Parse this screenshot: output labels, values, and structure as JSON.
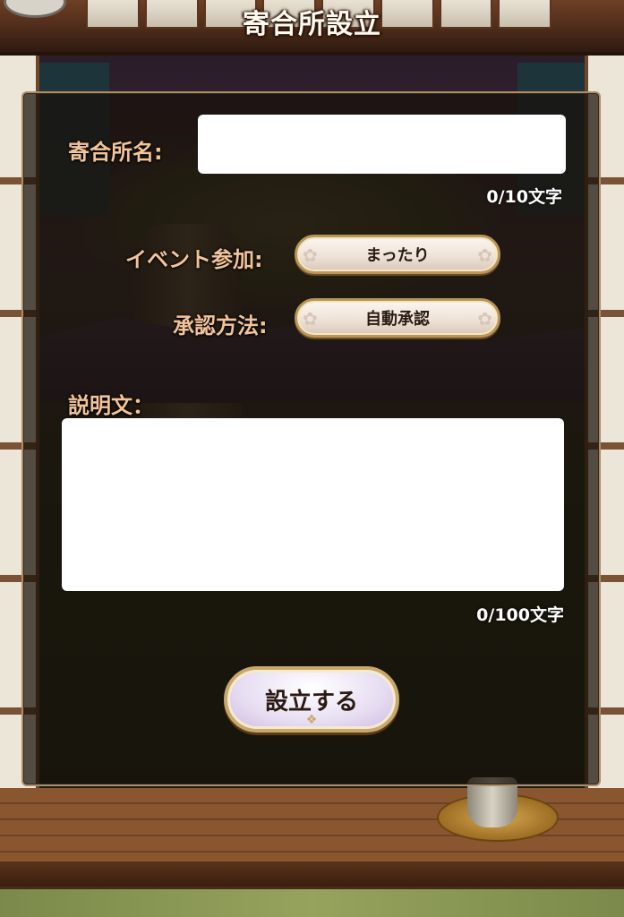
{
  "header": {
    "title": "寄合所設立"
  },
  "form": {
    "name_label": "寄合所名:",
    "name_value": "",
    "name_count": "0/10文字",
    "event_label": "イベント参加:",
    "event_value": "まったり",
    "approval_label": "承認方法:",
    "approval_value": "自動承認",
    "desc_label": "説明文：",
    "desc_value": "",
    "desc_count": "0/100文字",
    "submit_label": "設立する"
  },
  "icons": {
    "pill_ornament": "cherry-blossom-icon",
    "submit_ornament": "crest-ornament-icon"
  },
  "colors": {
    "label": "#f2c49a",
    "panel_border": "#a88e6c",
    "button_border": "#b89658"
  }
}
